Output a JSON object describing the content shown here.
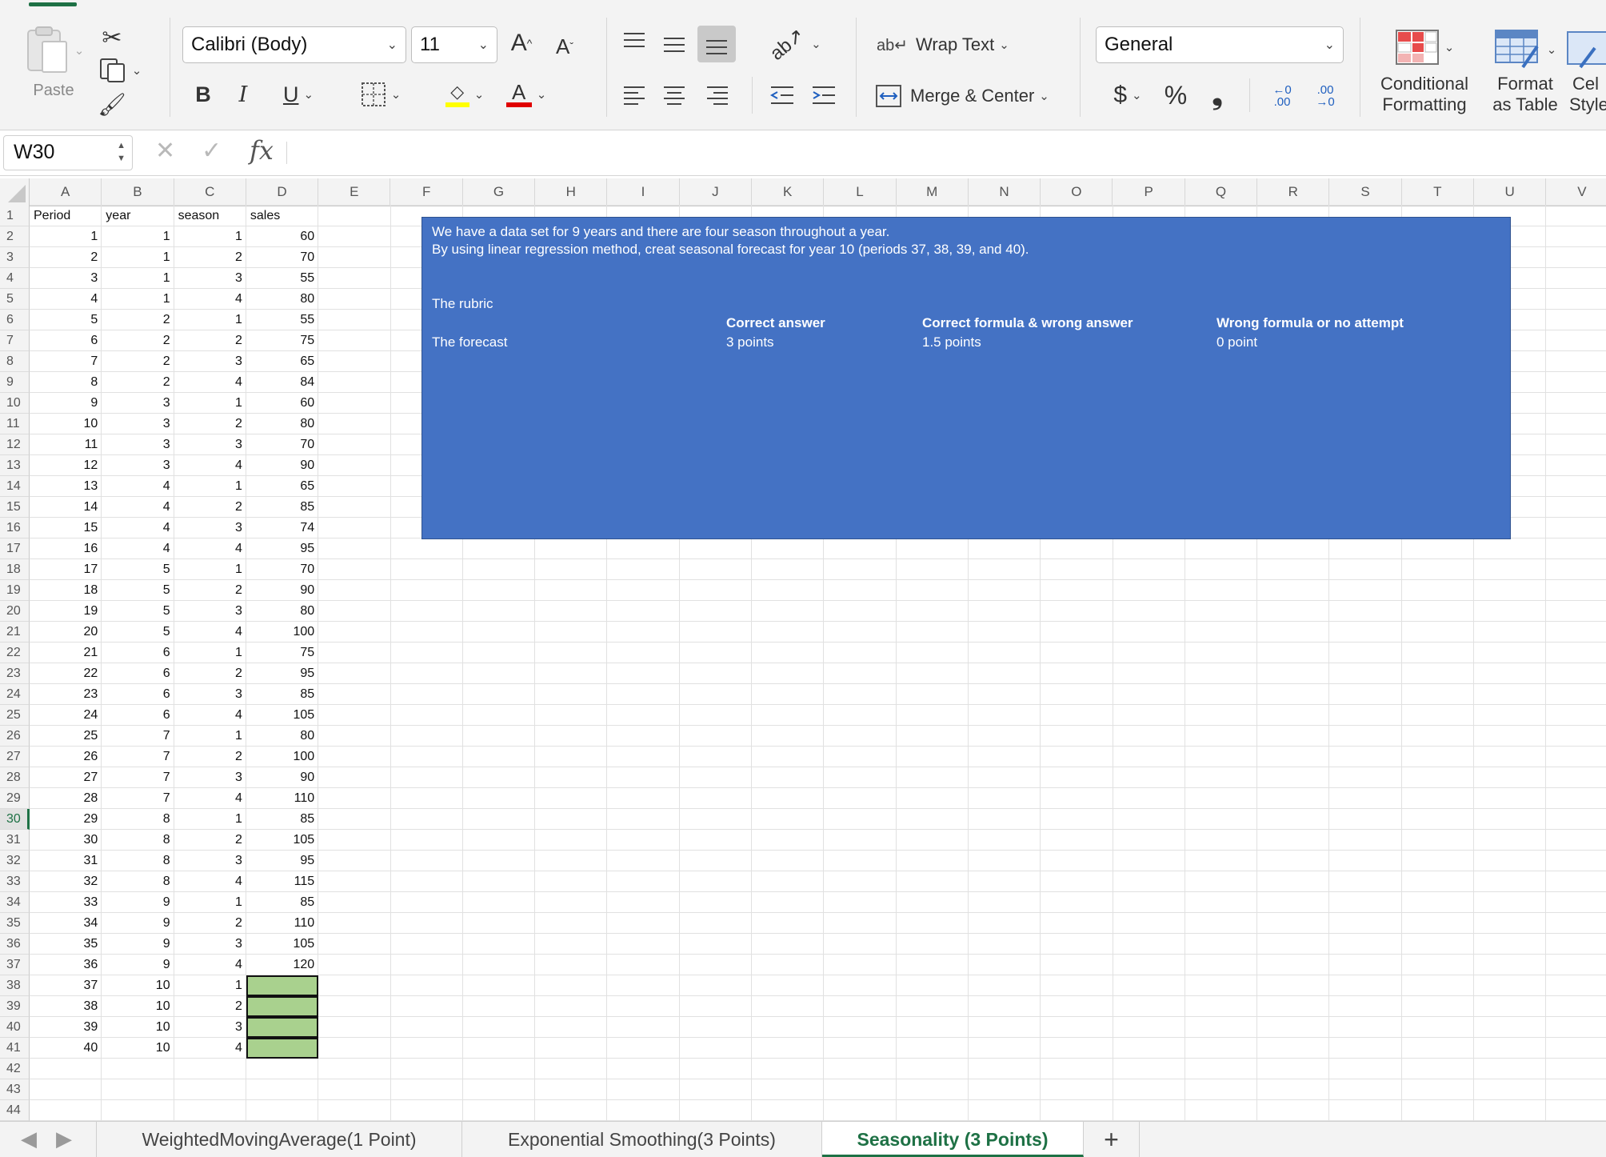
{
  "ribbon": {
    "paste_label": "Paste",
    "font_name": "Calibri (Body)",
    "font_size": "11",
    "grow_font": "A",
    "shrink_font": "A",
    "bold": "B",
    "italic": "I",
    "underline": "U",
    "font_color_glyph": "A",
    "wrap_text_label": "Wrap Text",
    "merge_center_label": "Merge & Center",
    "number_format": "General",
    "currency": "$",
    "percent": "%",
    "comma": "❟",
    "increase_decimal": "←0 .00",
    "decrease_decimal": ".00 →0",
    "conditional_formatting_l1": "Conditional",
    "conditional_formatting_l2": "Formatting",
    "format_table_l1": "Format",
    "format_table_l2": "as Table",
    "cell_styles_l1": "Cel",
    "cell_styles_l2": "Style",
    "colors": {
      "fill_bar": "#ffff00",
      "font_bar": "#e00000",
      "accent": "#1e7145"
    }
  },
  "formula_bar": {
    "name_box": "W30",
    "fx": "fx",
    "formula": ""
  },
  "columns": [
    "A",
    "B",
    "C",
    "D",
    "E",
    "F",
    "G",
    "H",
    "I",
    "J",
    "K",
    "L",
    "M",
    "N",
    "O",
    "P",
    "Q",
    "R",
    "S",
    "T",
    "U",
    "V"
  ],
  "row_numbers": [
    "1",
    "2",
    "3",
    "4",
    "5",
    "6",
    "7",
    "8",
    "9",
    "10",
    "11",
    "12",
    "13",
    "14",
    "15",
    "16",
    "17",
    "18",
    "19",
    "20",
    "21",
    "22",
    "23",
    "24",
    "25",
    "26",
    "27",
    "28",
    "29",
    "30",
    "31",
    "32",
    "33",
    "34",
    "35",
    "36",
    "37",
    "38",
    "39",
    "40",
    "41",
    "42",
    "43",
    "44"
  ],
  "active_row": "30",
  "table": {
    "headers": [
      "Period",
      "year",
      "season",
      "sales"
    ],
    "rows": [
      [
        "1",
        "1",
        "1",
        "60"
      ],
      [
        "2",
        "1",
        "2",
        "70"
      ],
      [
        "3",
        "1",
        "3",
        "55"
      ],
      [
        "4",
        "1",
        "4",
        "80"
      ],
      [
        "5",
        "2",
        "1",
        "55"
      ],
      [
        "6",
        "2",
        "2",
        "75"
      ],
      [
        "7",
        "2",
        "3",
        "65"
      ],
      [
        "8",
        "2",
        "4",
        "84"
      ],
      [
        "9",
        "3",
        "1",
        "60"
      ],
      [
        "10",
        "3",
        "2",
        "80"
      ],
      [
        "11",
        "3",
        "3",
        "70"
      ],
      [
        "12",
        "3",
        "4",
        "90"
      ],
      [
        "13",
        "4",
        "1",
        "65"
      ],
      [
        "14",
        "4",
        "2",
        "85"
      ],
      [
        "15",
        "4",
        "3",
        "74"
      ],
      [
        "16",
        "4",
        "4",
        "95"
      ],
      [
        "17",
        "5",
        "1",
        "70"
      ],
      [
        "18",
        "5",
        "2",
        "90"
      ],
      [
        "19",
        "5",
        "3",
        "80"
      ],
      [
        "20",
        "5",
        "4",
        "100"
      ],
      [
        "21",
        "6",
        "1",
        "75"
      ],
      [
        "22",
        "6",
        "2",
        "95"
      ],
      [
        "23",
        "6",
        "3",
        "85"
      ],
      [
        "24",
        "6",
        "4",
        "105"
      ],
      [
        "25",
        "7",
        "1",
        "80"
      ],
      [
        "26",
        "7",
        "2",
        "100"
      ],
      [
        "27",
        "7",
        "3",
        "90"
      ],
      [
        "28",
        "7",
        "4",
        "110"
      ],
      [
        "29",
        "8",
        "1",
        "85"
      ],
      [
        "30",
        "8",
        "2",
        "105"
      ],
      [
        "31",
        "8",
        "3",
        "95"
      ],
      [
        "32",
        "8",
        "4",
        "115"
      ],
      [
        "33",
        "9",
        "1",
        "85"
      ],
      [
        "34",
        "9",
        "2",
        "110"
      ],
      [
        "35",
        "9",
        "3",
        "105"
      ],
      [
        "36",
        "9",
        "4",
        "120"
      ],
      [
        "37",
        "10",
        "1",
        ""
      ],
      [
        "38",
        "10",
        "2",
        ""
      ],
      [
        "39",
        "10",
        "3",
        ""
      ],
      [
        "40",
        "10",
        "4",
        ""
      ]
    ]
  },
  "forecast_fill_color": "#a9d18e",
  "textbox": {
    "line1": "We have a data set for 9 years and there are four season throughout a year.",
    "line2": "By using linear regression method, creat seasonal forecast for year 10 (periods 37, 38, 39, and 40).",
    "rubric_label": "The rubric",
    "forecast_label": "The forecast",
    "col1_title": "Correct answer",
    "col1_points": "3 points",
    "col2_title": "Correct formula & wrong answer",
    "col2_points": "1.5 points",
    "col3_title": "Wrong formula or no attempt",
    "col3_points": "0 point",
    "background": "#4472c4"
  },
  "sheet_tabs": [
    {
      "label": "WeightedMovingAverage(1 Point)",
      "active": false
    },
    {
      "label": "Exponential Smoothing(3 Points)",
      "active": false
    },
    {
      "label": "Seasonality (3 Points)",
      "active": true
    }
  ],
  "add_sheet": "+"
}
